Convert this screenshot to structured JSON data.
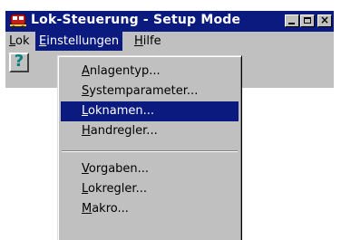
{
  "window": {
    "title": "Lok-Steuerung - Setup Mode",
    "controls": {
      "minimize": "minimize",
      "maximize": "maximize",
      "close": "×"
    }
  },
  "menubar": {
    "items": [
      {
        "label": "Lok",
        "mnemonic": "L"
      },
      {
        "label": "Einstellungen",
        "mnemonic": "E"
      },
      {
        "label": "Hilfe",
        "mnemonic": "H"
      }
    ],
    "active": "Einstellungen"
  },
  "toolbar": {
    "help_glyph": "?"
  },
  "dropdown": {
    "items": [
      {
        "label": "Anlagentyp...",
        "mnemonic": "A"
      },
      {
        "label": "Systemparameter...",
        "mnemonic": "S"
      },
      {
        "label": "Loknamen...",
        "mnemonic": "L",
        "selected": true
      },
      {
        "label": "Handregler...",
        "mnemonic": "H"
      },
      {
        "label": "Vorgaben...",
        "mnemonic": "V"
      },
      {
        "label": "Lokregler...",
        "mnemonic": "L"
      },
      {
        "label": "Makro...",
        "mnemonic": "M"
      }
    ]
  },
  "colors": {
    "titlebar": "#0a1a7e",
    "selection": "#0a1a7e",
    "face": "#c0c0c0",
    "help_glyph": "#008080"
  },
  "icons": {
    "app": "train-icon",
    "help": "help-icon"
  }
}
